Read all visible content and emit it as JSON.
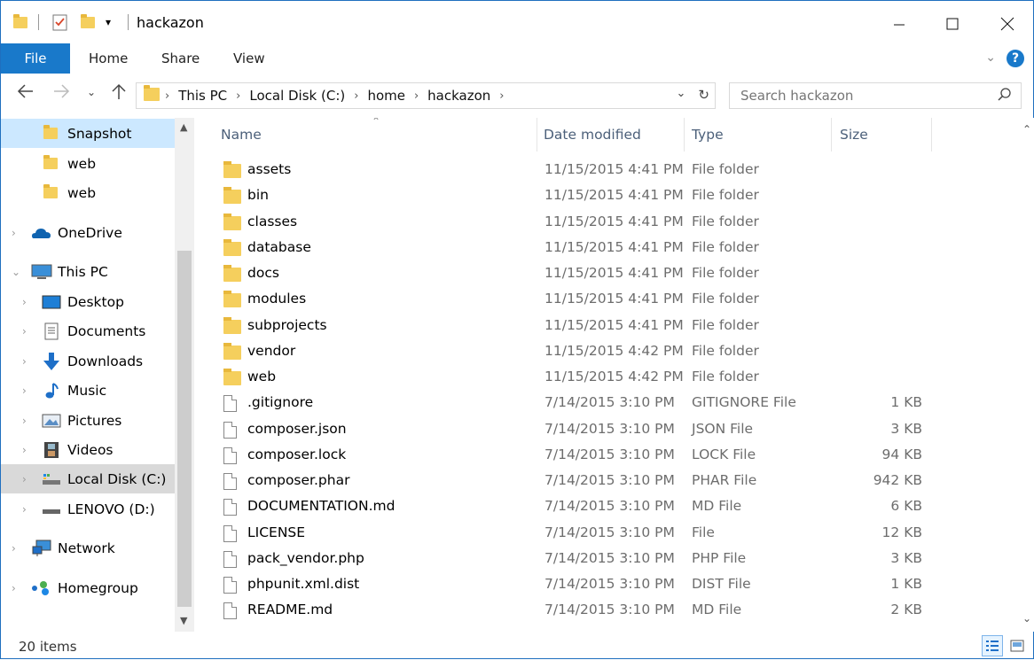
{
  "window": {
    "title": "hackazon"
  },
  "ribbon": {
    "tabs": [
      "File",
      "Home",
      "Share",
      "View"
    ]
  },
  "nav": {
    "breadcrumbs": [
      "This PC",
      "Local Disk (C:)",
      "home",
      "hackazon"
    ],
    "search_placeholder": "Search hackazon"
  },
  "sidebar": {
    "items": [
      {
        "label": "Snapshot",
        "icon": "folder-icon"
      },
      {
        "label": "web",
        "icon": "folder-icon"
      },
      {
        "label": "web",
        "icon": "folder-icon"
      },
      {
        "label": "OneDrive",
        "icon": "cloud-icon"
      },
      {
        "label": "This PC",
        "icon": "pc-icon"
      },
      {
        "label": "Desktop",
        "icon": "desktop-icon"
      },
      {
        "label": "Documents",
        "icon": "documents-icon"
      },
      {
        "label": "Downloads",
        "icon": "download-arrow-icon"
      },
      {
        "label": "Music",
        "icon": "music-note-icon"
      },
      {
        "label": "Pictures",
        "icon": "pictures-icon"
      },
      {
        "label": "Videos",
        "icon": "film-icon"
      },
      {
        "label": "Local Disk (C:)",
        "icon": "drive-icon"
      },
      {
        "label": "LENOVO (D:)",
        "icon": "drive-icon"
      },
      {
        "label": "Network",
        "icon": "network-icon"
      },
      {
        "label": "Homegroup",
        "icon": "homegroup-icon"
      }
    ]
  },
  "columns": {
    "name": "Name",
    "date": "Date modified",
    "type": "Type",
    "size": "Size"
  },
  "files": [
    {
      "name": "assets",
      "date": "11/15/2015 4:41 PM",
      "type": "File folder",
      "size": "",
      "kind": "folder"
    },
    {
      "name": "bin",
      "date": "11/15/2015 4:41 PM",
      "type": "File folder",
      "size": "",
      "kind": "folder"
    },
    {
      "name": "classes",
      "date": "11/15/2015 4:41 PM",
      "type": "File folder",
      "size": "",
      "kind": "folder"
    },
    {
      "name": "database",
      "date": "11/15/2015 4:41 PM",
      "type": "File folder",
      "size": "",
      "kind": "folder"
    },
    {
      "name": "docs",
      "date": "11/15/2015 4:41 PM",
      "type": "File folder",
      "size": "",
      "kind": "folder"
    },
    {
      "name": "modules",
      "date": "11/15/2015 4:41 PM",
      "type": "File folder",
      "size": "",
      "kind": "folder"
    },
    {
      "name": "subprojects",
      "date": "11/15/2015 4:41 PM",
      "type": "File folder",
      "size": "",
      "kind": "folder"
    },
    {
      "name": "vendor",
      "date": "11/15/2015 4:42 PM",
      "type": "File folder",
      "size": "",
      "kind": "folder"
    },
    {
      "name": "web",
      "date": "11/15/2015 4:42 PM",
      "type": "File folder",
      "size": "",
      "kind": "folder"
    },
    {
      "name": ".gitignore",
      "date": "7/14/2015 3:10 PM",
      "type": "GITIGNORE File",
      "size": "1 KB",
      "kind": "file"
    },
    {
      "name": "composer.json",
      "date": "7/14/2015 3:10 PM",
      "type": "JSON File",
      "size": "3 KB",
      "kind": "file"
    },
    {
      "name": "composer.lock",
      "date": "7/14/2015 3:10 PM",
      "type": "LOCK File",
      "size": "94 KB",
      "kind": "file"
    },
    {
      "name": "composer.phar",
      "date": "7/14/2015 3:10 PM",
      "type": "PHAR File",
      "size": "942 KB",
      "kind": "file"
    },
    {
      "name": "DOCUMENTATION.md",
      "date": "7/14/2015 3:10 PM",
      "type": "MD File",
      "size": "6 KB",
      "kind": "file"
    },
    {
      "name": "LICENSE",
      "date": "7/14/2015 3:10 PM",
      "type": "File",
      "size": "12 KB",
      "kind": "file"
    },
    {
      "name": "pack_vendor.php",
      "date": "7/14/2015 3:10 PM",
      "type": "PHP File",
      "size": "3 KB",
      "kind": "file"
    },
    {
      "name": "phpunit.xml.dist",
      "date": "7/14/2015 3:10 PM",
      "type": "DIST File",
      "size": "1 KB",
      "kind": "file"
    },
    {
      "name": "README.md",
      "date": "7/14/2015 3:10 PM",
      "type": "MD File",
      "size": "2 KB",
      "kind": "file"
    }
  ],
  "status": {
    "item_count": "20 items"
  },
  "colors": {
    "accent": "#1979ca",
    "selected": "#cce8ff",
    "folder": "#f5cf5d"
  }
}
